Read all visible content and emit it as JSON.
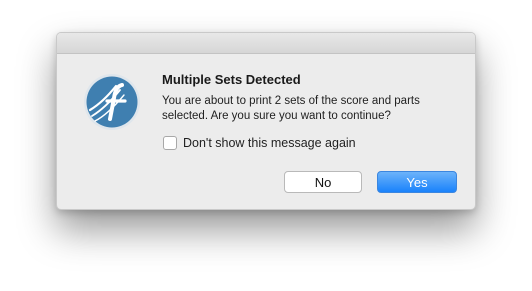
{
  "dialog": {
    "title": "Multiple Sets Detected",
    "message": "You are about to print 2 sets of the score and parts selected. Are you sure you want to continue?",
    "checkbox": {
      "label": "Don't show this message again",
      "checked": false
    },
    "buttons": {
      "no_label": "No",
      "yes_label": "Yes"
    },
    "icon": "finale-app-icon"
  },
  "colors": {
    "dialog_background": "#ececec",
    "primary_button": "#1a82fb",
    "icon_blue": "#3f7fb0"
  }
}
